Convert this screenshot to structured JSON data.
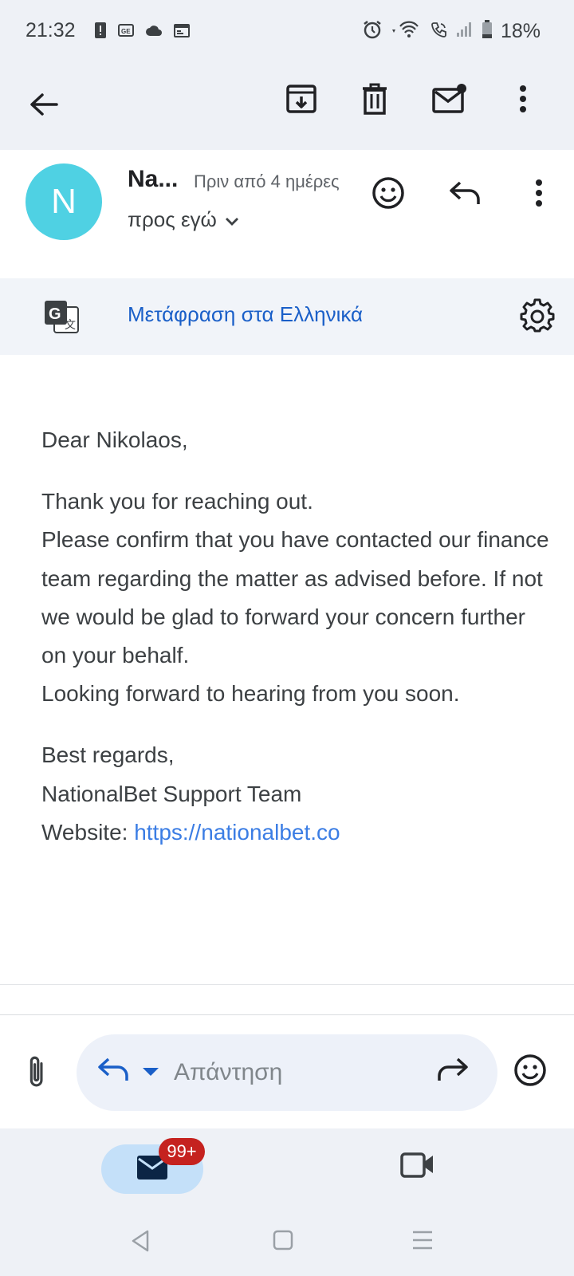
{
  "status_bar": {
    "time": "21:32",
    "battery": "18%",
    "left_icons": [
      "alert-icon",
      "news-icon",
      "cloud-icon",
      "calendar-icon"
    ],
    "right_icons": [
      "alarm-icon",
      "wifi-icon",
      "wifi-calling-icon",
      "signal-icon",
      "battery-icon"
    ]
  },
  "toolbar": {
    "back_icon": "arrow-left-icon",
    "actions": [
      "archive-icon",
      "delete-icon",
      "mark-unread-icon",
      "more-vert-icon"
    ]
  },
  "message_header": {
    "avatar_letter": "N",
    "sender": "Na...",
    "time_ago": "Πριν από 4 ημέρες",
    "recipient": "προς εγώ"
  },
  "translate_bar": {
    "link": "Μετάφραση στα Ελληνικά"
  },
  "email_body": {
    "greeting": "Dear Nikolaos,",
    "p1_line1": "Thank you for reaching out.",
    "p1_line2": "Please confirm that you have contacted our finance team regarding the matter as advised before. If not we would be glad to forward your concern further on your behalf.",
    "p1_line3": "Looking forward to hearing from you soon.",
    "sign_line1": "Best regards,",
    "sign_line2": "NationalBet Support Team",
    "website_label": "Website: ",
    "website_url": "https://nationalbet.co"
  },
  "reply_bar": {
    "placeholder": "Απάντηση"
  },
  "bottom_nav": {
    "mail_badge": "99+"
  },
  "colors": {
    "accent": "#1a5fc8",
    "avatar": "#4fd1e3",
    "badge": "#c5221f",
    "link": "#3b7de4"
  }
}
